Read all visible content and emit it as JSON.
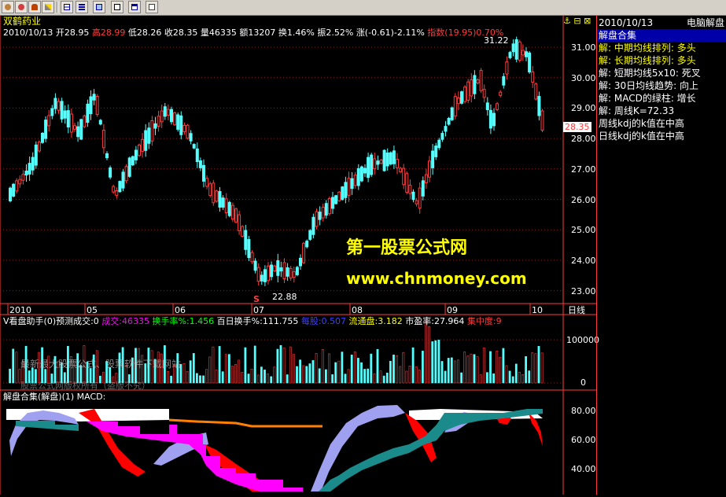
{
  "toolbar": {
    "icons": [
      "home-icon",
      "alarm-icon",
      "bell-icon",
      "draw-icon",
      "split-icon",
      "list-icon",
      "grid-icon",
      "calc-icon",
      "window-icon",
      "page-icon"
    ]
  },
  "header": {
    "stock_name": "双鹤药业",
    "date": "2010/10/13",
    "open": "开28.95",
    "high": "高28.99",
    "low": "低28.26",
    "close": "收28.35",
    "volume": "量46335",
    "amount": "额13207",
    "turnover": "换1.46%",
    "amplitude": "振2.52%",
    "change": "涨(-0.61)-2.11%",
    "index": "指数(19.95)0.70%"
  },
  "price_chart": {
    "axis_labels": [
      "31.00",
      "30.00",
      "29.00",
      "28.00",
      "27.00",
      "26.00",
      "25.00",
      "24.00",
      "23.00"
    ],
    "current_price": "28.35",
    "high_marker": "31.22",
    "low_marker": "22.88",
    "s_marker": "S",
    "month_labels": [
      "2010",
      "05",
      "06",
      "07",
      "08",
      "09",
      "10"
    ],
    "period": "日线"
  },
  "volume_panel": {
    "title": "V看盘助手(0)预测成交:0",
    "chengjiao": "成交:46335",
    "turnover_rate": "换手率%:1.456",
    "hundred_day": "百日换手%:111.755",
    "eps": "每股:0.507",
    "float": "流通盘:3.182",
    "pe": "市盈率:27.964",
    "concentration": "集中度:9",
    "axis_labels": [
      "100000",
      "0"
    ],
    "watermark1": "最新最大股票公式、股票软件下载网站",
    "watermark2": "股票公式网版权所有（盗版不究）"
  },
  "macd_panel": {
    "title": "解盘合集(解盘)(1) MACD:",
    "axis_labels": [
      "80.00",
      "60.00",
      "40.00"
    ]
  },
  "overlay": {
    "site_name": "第一股票公式网",
    "site_url": "www.chnmoney.com"
  },
  "sidebar": {
    "date": "2010/10/13",
    "title": "电脑解盘",
    "section": "解盘合集",
    "items": [
      "解: 中期均线排列: 多头",
      "解: 长期均线排列: 多头",
      "解: 短期均线5x10: 死叉",
      "解: 30日均线趋势: 向上",
      "解: MACD的绿柱: 增长",
      "解: 周线K=72.33",
      "周线kdj的k值在中高",
      "日线kdj的k值在中高"
    ]
  },
  "colors": {
    "up": "#ff3b3b",
    "down": "#54ffff",
    "axis": "#ff3b3b",
    "yellow": "#ffff00",
    "highlight_bar": "#0000a8",
    "white": "#ffffff"
  }
}
